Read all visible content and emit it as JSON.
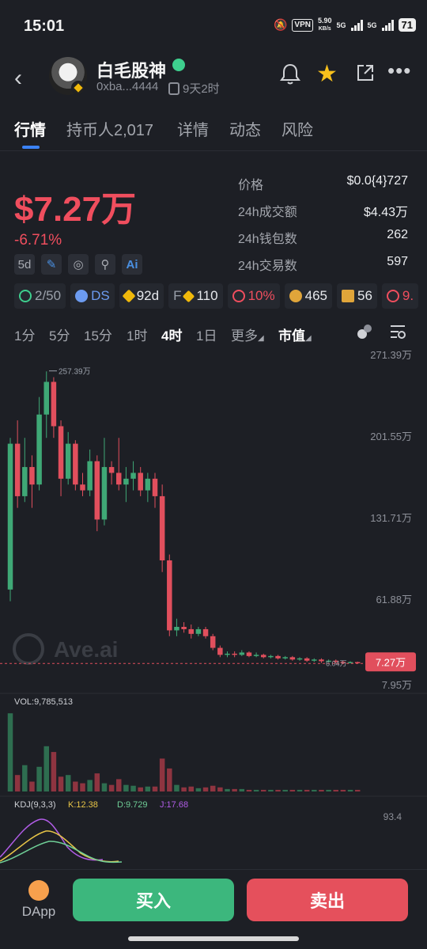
{
  "status_bar": {
    "time": "15:01",
    "vpn": "VPN",
    "speed_value": "5.90",
    "speed_unit": "KB/s",
    "net1": "5G",
    "net2": "5G",
    "battery": "71"
  },
  "header": {
    "token_name": "白毛股神",
    "address": "0xba...4444",
    "age": "9天2时"
  },
  "tabs": [
    "行情",
    "持币人2,017",
    "详情",
    "动态",
    "风险"
  ],
  "price": {
    "value": "$7.27万",
    "change": "-6.71%",
    "period_chip": "5d"
  },
  "stats": [
    {
      "label": "价格",
      "value": "$0.0{4}727"
    },
    {
      "label": "24h成交额",
      "value": "$4.43万"
    },
    {
      "label": "24h钱包数",
      "value": "262"
    },
    {
      "label": "24h交易数",
      "value": "597"
    }
  ],
  "badges": [
    {
      "icon": "user-icon",
      "text": "2/50",
      "color": "#9aa0aa"
    },
    {
      "icon": "chef-icon",
      "text": "DS",
      "color": "#6c9bf0"
    },
    {
      "icon": "bnb-icon",
      "text": "92d",
      "color": "#eceef1"
    },
    {
      "icon": "f-icon",
      "text": "110",
      "color": "#eceef1"
    },
    {
      "icon": "link-icon",
      "text": "10%",
      "color": "#f04e5e"
    },
    {
      "icon": "moneybag-icon",
      "text": "465",
      "color": "#eceef1"
    },
    {
      "icon": "trophy-icon",
      "text": "56",
      "color": "#eceef1"
    },
    {
      "icon": "alien-icon",
      "text": "9.",
      "color": "#f04e5e"
    }
  ],
  "timeframes": [
    "1分",
    "5分",
    "15分",
    "1时",
    "4时",
    "1日",
    "更多",
    "市值"
  ],
  "chart_data": {
    "type": "candlestick",
    "price_axis": [
      "271.39万",
      "201.55万",
      "131.71万",
      "61.88万",
      "7.95万"
    ],
    "high_label": "257.39万",
    "low_label": "6.04万",
    "current_price_tag": "7.27万",
    "watermark": "Ave.ai",
    "candles": [
      {
        "o": 70,
        "c": 195,
        "h": 200,
        "l": 60
      },
      {
        "o": 195,
        "c": 150,
        "h": 215,
        "l": 140
      },
      {
        "o": 150,
        "c": 175,
        "h": 200,
        "l": 145
      },
      {
        "o": 175,
        "c": 160,
        "h": 185,
        "l": 140
      },
      {
        "o": 160,
        "c": 220,
        "h": 235,
        "l": 155
      },
      {
        "o": 220,
        "c": 248,
        "h": 257,
        "l": 200
      },
      {
        "o": 248,
        "c": 210,
        "h": 252,
        "l": 200
      },
      {
        "o": 210,
        "c": 165,
        "h": 215,
        "l": 150
      },
      {
        "o": 165,
        "c": 195,
        "h": 205,
        "l": 160
      },
      {
        "o": 195,
        "c": 160,
        "h": 198,
        "l": 155
      },
      {
        "o": 160,
        "c": 155,
        "h": 170,
        "l": 150
      },
      {
        "o": 155,
        "c": 180,
        "h": 190,
        "l": 150
      },
      {
        "o": 180,
        "c": 130,
        "h": 185,
        "l": 120
      },
      {
        "o": 130,
        "c": 175,
        "h": 200,
        "l": 125
      },
      {
        "o": 175,
        "c": 170,
        "h": 180,
        "l": 160
      },
      {
        "o": 170,
        "c": 160,
        "h": 200,
        "l": 155
      },
      {
        "o": 160,
        "c": 165,
        "h": 175,
        "l": 145
      },
      {
        "o": 165,
        "c": 170,
        "h": 180,
        "l": 155
      },
      {
        "o": 170,
        "c": 155,
        "h": 175,
        "l": 150
      },
      {
        "o": 155,
        "c": 165,
        "h": 170,
        "l": 145
      },
      {
        "o": 165,
        "c": 150,
        "h": 170,
        "l": 140
      },
      {
        "o": 150,
        "c": 95,
        "h": 160,
        "l": 85
      },
      {
        "o": 95,
        "c": 35,
        "h": 100,
        "l": 30
      },
      {
        "o": 35,
        "c": 38,
        "h": 45,
        "l": 30
      },
      {
        "o": 38,
        "c": 36,
        "h": 42,
        "l": 33
      },
      {
        "o": 36,
        "c": 32,
        "h": 40,
        "l": 28
      },
      {
        "o": 32,
        "c": 36,
        "h": 38,
        "l": 30
      },
      {
        "o": 36,
        "c": 30,
        "h": 38,
        "l": 28
      },
      {
        "o": 30,
        "c": 20,
        "h": 32,
        "l": 18
      },
      {
        "o": 20,
        "c": 14,
        "h": 22,
        "l": 12
      },
      {
        "o": 14,
        "c": 15,
        "h": 17,
        "l": 12
      },
      {
        "o": 15,
        "c": 14,
        "h": 17,
        "l": 12
      },
      {
        "o": 14,
        "c": 16,
        "h": 18,
        "l": 13
      },
      {
        "o": 16,
        "c": 13,
        "h": 17,
        "l": 12
      },
      {
        "o": 13,
        "c": 14,
        "h": 16,
        "l": 12
      },
      {
        "o": 14,
        "c": 12,
        "h": 15,
        "l": 11
      },
      {
        "o": 12,
        "c": 13,
        "h": 14,
        "l": 11
      },
      {
        "o": 13,
        "c": 11,
        "h": 14,
        "l": 10
      },
      {
        "o": 11,
        "c": 12,
        "h": 13,
        "l": 10
      },
      {
        "o": 12,
        "c": 10,
        "h": 13,
        "l": 9
      },
      {
        "o": 10,
        "c": 11,
        "h": 12,
        "l": 9
      },
      {
        "o": 11,
        "c": 9,
        "h": 12,
        "l": 8
      },
      {
        "o": 9,
        "c": 10,
        "h": 11,
        "l": 8
      },
      {
        "o": 10,
        "c": 8.5,
        "h": 11,
        "l": 7
      },
      {
        "o": 8.5,
        "c": 9,
        "h": 10,
        "l": 7.5
      },
      {
        "o": 9,
        "c": 8,
        "h": 10,
        "l": 6.5
      },
      {
        "o": 8,
        "c": 7.5,
        "h": 9,
        "l": 6.04
      },
      {
        "o": 7.5,
        "c": 7.8,
        "h": 8.5,
        "l": 7
      },
      {
        "o": 7.8,
        "c": 7.27,
        "h": 8.2,
        "l": 7
      }
    ],
    "volume_label": "VOL:9,785,513",
    "volumes": [
      0.95,
      0.2,
      0.32,
      0.12,
      0.3,
      0.55,
      0.48,
      0.18,
      0.2,
      0.12,
      0.1,
      0.14,
      0.22,
      0.1,
      0.08,
      0.15,
      0.08,
      0.07,
      0.05,
      0.06,
      0.06,
      0.4,
      0.28,
      0.08,
      0.05,
      0.06,
      0.04,
      0.05,
      0.07,
      0.05,
      0.03,
      0.03,
      0.03,
      0.02,
      0.02,
      0.02,
      0.02,
      0.02,
      0.02,
      0.02,
      0.02,
      0.02,
      0.02,
      0.02,
      0.02,
      0.02,
      0.02,
      0.02,
      0.02
    ],
    "kdj_label": "KDJ(9,3,3)",
    "kdj_k": "K:12.38",
    "kdj_d": "D:9.729",
    "kdj_j": "J:17.68",
    "kdj_axis": "93.4",
    "colors": {
      "up": "#3fa876",
      "down": "#e14f5d",
      "k": "#e8c547",
      "d": "#6fcf97",
      "j": "#b05ce6"
    }
  },
  "bottom": {
    "dapp_label": "DApp",
    "buy_label": "买入",
    "sell_label": "卖出"
  }
}
